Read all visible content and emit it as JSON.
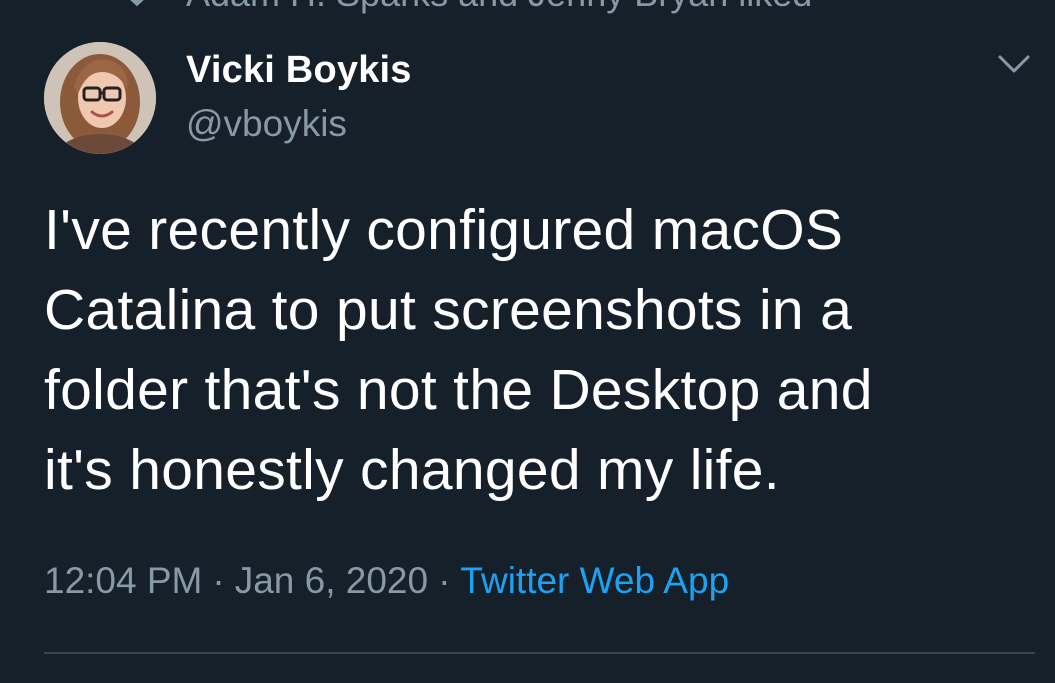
{
  "social_context": {
    "icon": "heart-icon",
    "text": "Adam H. Sparks and Jenny Bryan liked"
  },
  "author": {
    "display_name": "Vicki Boykis",
    "handle": "@vboykis",
    "avatar": "avatar-photo"
  },
  "menu": {
    "icon": "chevron-down-icon"
  },
  "tweet": {
    "lines": [
      "I've recently configured macOS",
      "Catalina to put screenshots in a",
      "folder that's not the Desktop and",
      "it's honestly changed my life."
    ]
  },
  "meta": {
    "time": "12:04 PM",
    "separator": "·",
    "date": "Jan 6, 2020",
    "source": "Twitter Web App"
  },
  "colors": {
    "background": "#15202b",
    "text": "#ffffff",
    "secondary": "#8899a6",
    "link": "#1da1f2",
    "divider": "#38444d"
  }
}
